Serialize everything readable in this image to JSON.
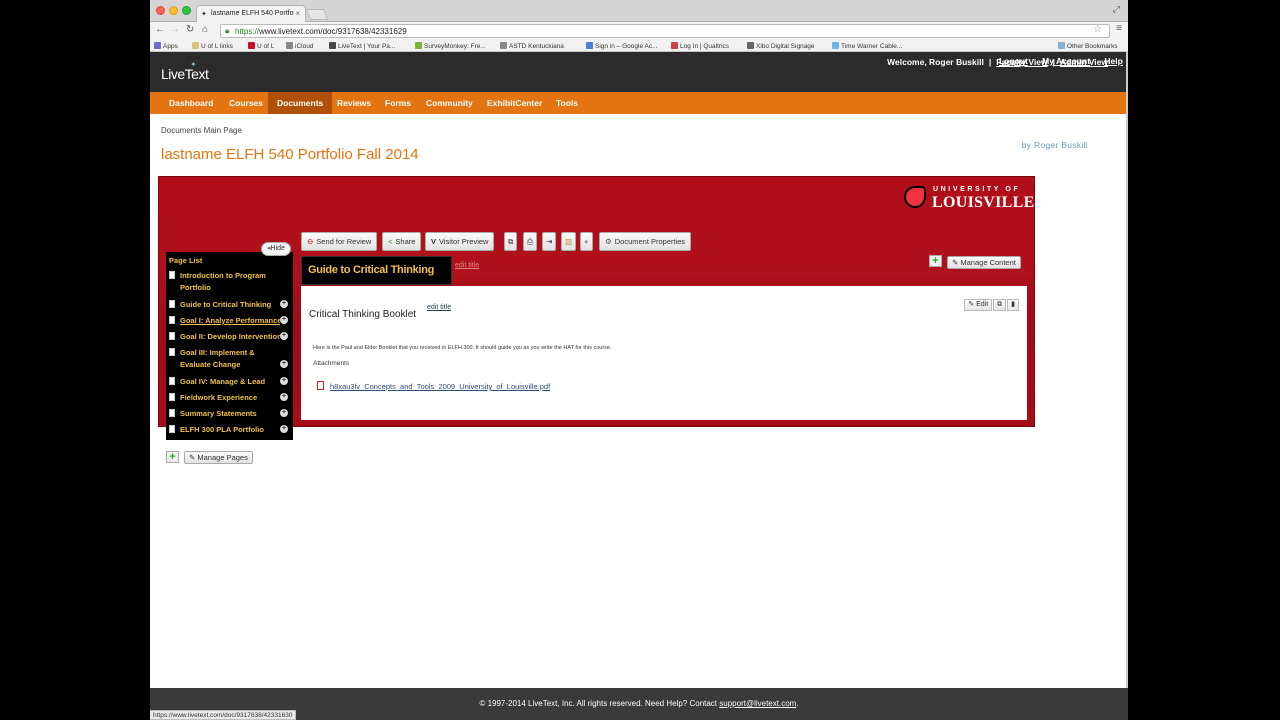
{
  "browser": {
    "tab_title": "lastname ELFH 540 Portfo",
    "url_scheme": "https://",
    "url_rest": "www.livetext.com/doc/9317638/42331629",
    "bookmarks": [
      "Apps",
      "U of L links",
      "U of L",
      "iCloud",
      "LiveText | Your Pa...",
      "SurveyMonkey: Fre...",
      "ASTD Kentuckiana",
      "Sign in – Google Ac...",
      "Log In | Qualtrics",
      "Xibo Digital Signage",
      "Time Warner Cable...",
      "Other Bookmarks"
    ],
    "status_url": "https://www.livetext.com/doc/9317638/42331630"
  },
  "header": {
    "logo": "LiveText",
    "welcome": "Welcome, Roger Buskill",
    "faculty_view": "Faculty View",
    "admin_view": "Admin View",
    "logout": "Logout",
    "my_account": "My Account",
    "help": "Help"
  },
  "nav": {
    "items": [
      "Dashboard",
      "Courses",
      "Documents",
      "Reviews",
      "Forms",
      "Community",
      "ExhibitCenter",
      "Tools"
    ],
    "active": "Documents"
  },
  "breadcrumb": "Documents Main Page",
  "document": {
    "title": "lastname ELFH 540 Portfolio Fall 2014",
    "byline": "by Roger Buskill"
  },
  "banner": {
    "university_top": "UNIVERSITY OF",
    "university_name": "LOUISVILLE"
  },
  "toolbar": {
    "send_for_review": "Send for Review",
    "share": "Share",
    "visitor_preview": "Visitor Preview",
    "document_properties": "Document Properties"
  },
  "page_list": {
    "hide": "Hide",
    "title": "Page List",
    "items": [
      "Introduction to Program Portfolio",
      "Guide to Critical Thinking",
      "Goal I: Analyze Performance",
      "Goal II: Develop Intervention",
      "Goal III: Implement & Evaluate Change",
      "Goal IV: Manage & Lead",
      "Fieldwork Experience",
      "Summary Statements",
      "ELFH 300 PLA Portfolio"
    ],
    "manage_pages": "Manage Pages"
  },
  "page": {
    "tab_title": "Guide to Critical Thinking",
    "edit_title": "edit title",
    "manage_content": "Manage Content"
  },
  "section": {
    "title": "Critical Thinking Booklet",
    "edit_title": "edit title",
    "edit": "Edit",
    "description": "Here is the Paul and Elder Booklet that you received in ELFH 300.  It should guide you as you write the HAT for this course.",
    "attachments_label": "Attachments",
    "attachment_file": "h8xau3lv_Concepts_and_Tools_2009_University_of_Louisville.pdf"
  },
  "footer": {
    "text": "© 1997-2014 LiveText, Inc. All rights reserved. Need Help? Contact ",
    "email": "support@livetext.com",
    "period": "."
  },
  "colors": {
    "orange": "#e47411",
    "nav_active": "#b04f06",
    "banner_red": "#b00f1a",
    "gold": "#f0c14b"
  }
}
